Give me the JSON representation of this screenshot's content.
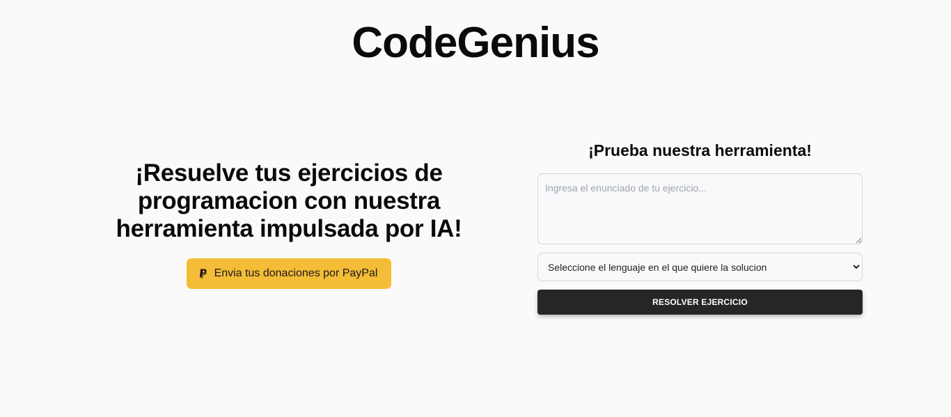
{
  "header": {
    "title": "CodeGenius"
  },
  "hero": {
    "heading": "¡Resuelve tus ejercicios de programacion con nuestra herramienta impulsada por IA!",
    "donate_button": {
      "label": "Envia tus donaciones por PayPal",
      "icon": "paypal-icon"
    }
  },
  "tool": {
    "heading": "¡Prueba nuestra herramienta!",
    "exercise_input": {
      "value": "",
      "placeholder": "Ingresa el enunciado de tu ejercicio..."
    },
    "language_select": {
      "selected": "Seleccione el lenguaje en el que quiere la solucion"
    },
    "solve_button_label": "RESOLVER EJERCICIO"
  },
  "colors": {
    "background": "#fafafa",
    "donate_button": "#f5bc37",
    "solve_button": "#262626",
    "text": "#0a0a0a"
  }
}
